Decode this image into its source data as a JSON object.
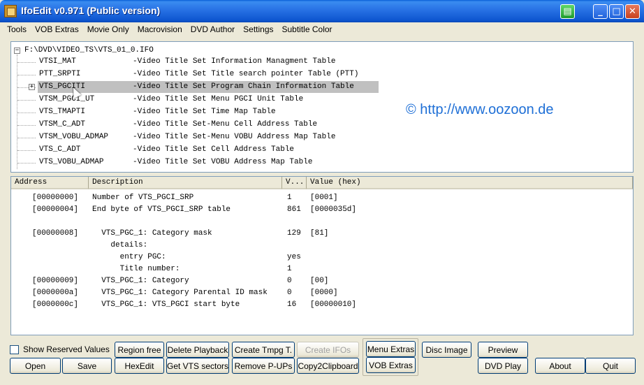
{
  "window": {
    "title": "IfoEdit v0.971 (Public version)"
  },
  "menu": [
    "Tools",
    "VOB Extras",
    "Movie Only",
    "Macrovision",
    "DVD Author",
    "Settings",
    "Subtitle Color"
  ],
  "tree": {
    "root": "F:\\DVD\\VIDEO_TS\\VTS_01_0.IFO",
    "items": [
      {
        "name": "VTSI_MAT",
        "desc": "-Video Title Set Information Managment Table"
      },
      {
        "name": "PTT_SRPTI",
        "desc": "-Video Title Set Title search pointer Table (PTT)"
      },
      {
        "name": "VTS_PGCITI",
        "desc": "-Video Title Set Program Chain Information Table"
      },
      {
        "name": "VTSM_PGCI_UT",
        "desc": "-Video Title Set Menu PGCI Unit Table"
      },
      {
        "name": "VTS_TMAPTI",
        "desc": "-Video Title Set Time Map Table"
      },
      {
        "name": "VTSM_C_ADT",
        "desc": "-Video Title Set-Menu Cell Address Table"
      },
      {
        "name": "VTSM_VOBU_ADMAP",
        "desc": "-Video Title Set-Menu VOBU Address Map Table"
      },
      {
        "name": "VTS_C_ADT",
        "desc": "-Video Title Set Cell Address Table"
      },
      {
        "name": "VTS_VOBU_ADMAP",
        "desc": "-Video Title Set VOBU Address Map Table"
      }
    ]
  },
  "watermark": "© http://www.oozoon.de",
  "detail": {
    "columns": [
      "Address",
      "Description",
      "V...",
      "Value (hex)"
    ],
    "rows": [
      {
        "addr": "[00000000]",
        "desc": "Number of VTS_PGCI_SRP",
        "val": "1",
        "hex": "[0001]"
      },
      {
        "addr": "[00000004]",
        "desc": "End byte of VTS_PGCI_SRP table",
        "val": "861",
        "hex": "[0000035d]"
      },
      {
        "addr": "",
        "desc": "",
        "val": "",
        "hex": ""
      },
      {
        "addr": "[00000008]",
        "desc": "  VTS_PGC_1: Category mask",
        "val": "129",
        "hex": "[81]"
      },
      {
        "addr": "",
        "desc": "    details:",
        "val": "",
        "hex": ""
      },
      {
        "addr": "",
        "desc": "      entry PGC:",
        "val": "yes",
        "hex": ""
      },
      {
        "addr": "",
        "desc": "      Title number:",
        "val": "1",
        "hex": ""
      },
      {
        "addr": "[00000009]",
        "desc": "  VTS_PGC_1: Category",
        "val": "0",
        "hex": "[00]"
      },
      {
        "addr": "[0000000a]",
        "desc": "  VTS_PGC_1: Category Parental ID mask",
        "val": "0",
        "hex": "[0000]"
      },
      {
        "addr": "[0000000c]",
        "desc": "  VTS_PGC_1: VTS_PGCI start byte",
        "val": "16",
        "hex": "[00000010]"
      }
    ]
  },
  "controls": {
    "show_reserved": "Show Reserved Values",
    "open": "Open",
    "save": "Save",
    "region_free": "Region free",
    "hexedit": "HexEdit",
    "delete_playback": "Delete Playback",
    "get_vts_sectors": "Get VTS sectors",
    "create_tmpg": "Create Tmpg T.",
    "remove_pups": "Remove P-UPs",
    "create_ifos": "Create IFOs",
    "copy2clipboard": "Copy2Clipboard",
    "menu_extras": "Menu Extras",
    "vob_extras": "VOB Extras",
    "disc_image": "Disc Image",
    "preview": "Preview",
    "dvd_play": "DVD Play",
    "about": "About",
    "quit": "Quit"
  }
}
